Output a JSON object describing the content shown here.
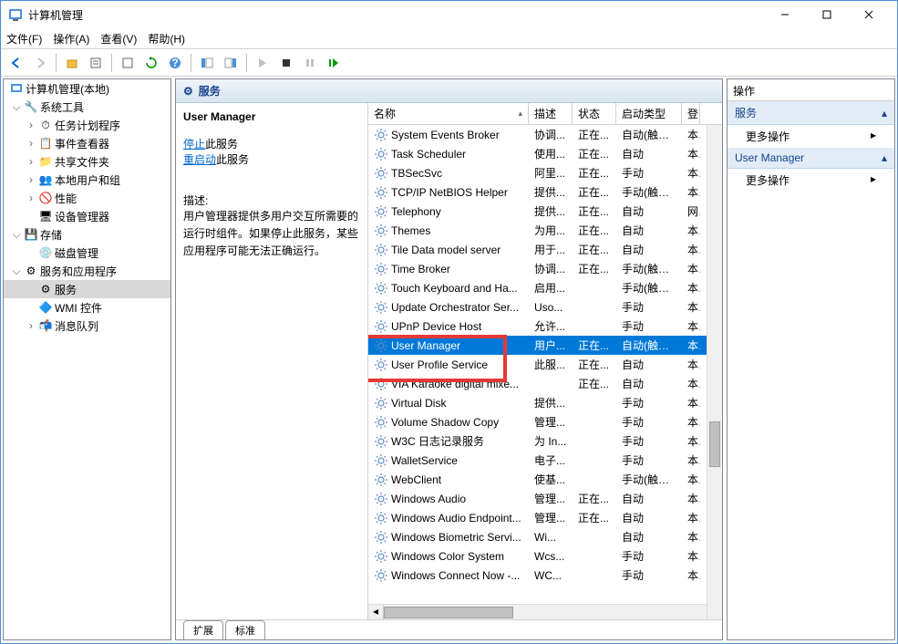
{
  "window": {
    "title": "计算机管理"
  },
  "menu": {
    "file": "文件(F)",
    "action": "操作(A)",
    "view": "查看(V)",
    "help": "帮助(H)"
  },
  "tree": {
    "root": "计算机管理(本地)",
    "sys_tools": "系统工具",
    "task_sched": "任务计划程序",
    "event_viewer": "事件查看器",
    "shared": "共享文件夹",
    "local_users": "本地用户和组",
    "perf": "性能",
    "dev_mgr": "设备管理器",
    "storage": "存储",
    "disk_mgmt": "磁盘管理",
    "svc_apps": "服务和应用程序",
    "services": "服务",
    "wmi": "WMI 控件",
    "msmq": "消息队列"
  },
  "middle": {
    "header_icon": "gear-icon",
    "header": "服务",
    "detail_title": "User Manager",
    "stop_link": "停止",
    "stop_suffix": "此服务",
    "restart_link": "重启动",
    "restart_suffix": "此服务",
    "desc_label": "描述:",
    "desc_text": "用户管理器提供多用户交互所需要的运行时组件。如果停止此服务，某些应用程序可能无法正确运行。",
    "tabs": {
      "ext": "扩展",
      "std": "标准"
    }
  },
  "cols": {
    "name": "名称",
    "desc": "描述",
    "status": "状态",
    "startup": "启动类型",
    "logon": "登"
  },
  "services": [
    {
      "n": "System Events Broker",
      "d": "协调...",
      "s": "正在...",
      "t": "自动(触发...",
      "l": "本"
    },
    {
      "n": "Task Scheduler",
      "d": "使用...",
      "s": "正在...",
      "t": "自动",
      "l": "本"
    },
    {
      "n": "TBSecSvc",
      "d": "阿里...",
      "s": "正在...",
      "t": "手动",
      "l": "本"
    },
    {
      "n": "TCP/IP NetBIOS Helper",
      "d": "提供...",
      "s": "正在...",
      "t": "手动(触发...",
      "l": "本"
    },
    {
      "n": "Telephony",
      "d": "提供...",
      "s": "正在...",
      "t": "自动",
      "l": "网"
    },
    {
      "n": "Themes",
      "d": "为用...",
      "s": "正在...",
      "t": "自动",
      "l": "本"
    },
    {
      "n": "Tile Data model server",
      "d": "用于...",
      "s": "正在...",
      "t": "自动",
      "l": "本"
    },
    {
      "n": "Time Broker",
      "d": "协调...",
      "s": "正在...",
      "t": "手动(触发...",
      "l": "本"
    },
    {
      "n": "Touch Keyboard and Ha...",
      "d": "启用...",
      "s": "",
      "t": "手动(触发...",
      "l": "本"
    },
    {
      "n": "Update Orchestrator Ser...",
      "d": "Uso...",
      "s": "",
      "t": "手动",
      "l": "本"
    },
    {
      "n": "UPnP Device Host",
      "d": "允许...",
      "s": "",
      "t": "手动",
      "l": "本"
    },
    {
      "n": "User Manager",
      "d": "用户...",
      "s": "正在...",
      "t": "自动(触发...",
      "l": "本",
      "selected": true
    },
    {
      "n": "User Profile Service",
      "d": "此服...",
      "s": "正在...",
      "t": "自动",
      "l": "本"
    },
    {
      "n": "VIA Karaoke digital mixe...",
      "d": "",
      "s": "正在...",
      "t": "自动",
      "l": "本"
    },
    {
      "n": "Virtual Disk",
      "d": "提供...",
      "s": "",
      "t": "手动",
      "l": "本"
    },
    {
      "n": "Volume Shadow Copy",
      "d": "管理...",
      "s": "",
      "t": "手动",
      "l": "本"
    },
    {
      "n": "W3C 日志记录服务",
      "d": "为 In...",
      "s": "",
      "t": "手动",
      "l": "本"
    },
    {
      "n": "WalletService",
      "d": "电子...",
      "s": "",
      "t": "手动",
      "l": "本"
    },
    {
      "n": "WebClient",
      "d": "使基...",
      "s": "",
      "t": "手动(触发...",
      "l": "本"
    },
    {
      "n": "Windows Audio",
      "d": "管理...",
      "s": "正在...",
      "t": "自动",
      "l": "本"
    },
    {
      "n": "Windows Audio Endpoint...",
      "d": "管理...",
      "s": "正在...",
      "t": "自动",
      "l": "本"
    },
    {
      "n": "Windows Biometric Servi...",
      "d": "Wi...",
      "s": "",
      "t": "自动",
      "l": "本"
    },
    {
      "n": "Windows Color System",
      "d": "Wcs...",
      "s": "",
      "t": "手动",
      "l": "本"
    },
    {
      "n": "Windows Connect Now -...",
      "d": "WC...",
      "s": "",
      "t": "手动",
      "l": "本"
    }
  ],
  "actions": {
    "title": "操作",
    "sec1": "服务",
    "more": "更多操作",
    "sec2": "User Manager"
  }
}
